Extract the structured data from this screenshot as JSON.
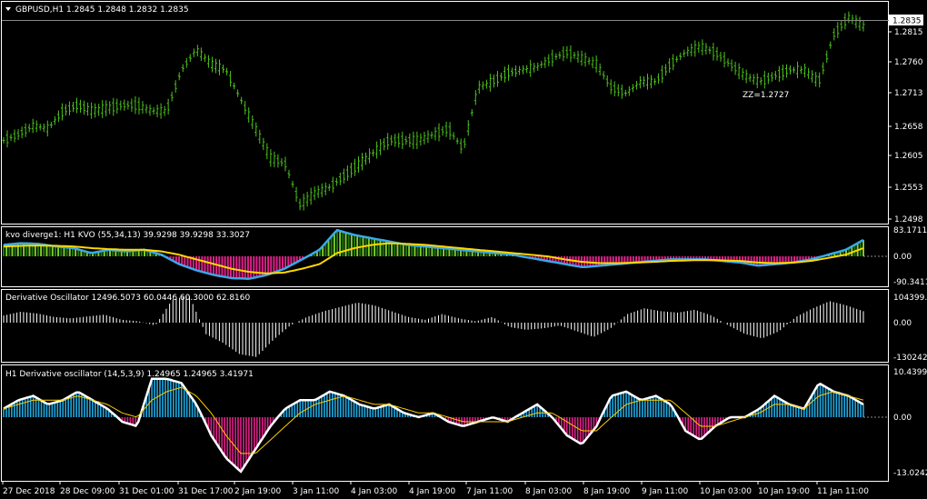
{
  "colors": {
    "background": "#000000",
    "frame": "#ffffff",
    "bull_bar": "#4cc21a",
    "histo_pos_dark": "#1f7a0a",
    "histo_pos_light": "#7ccd2a",
    "histo_neg": "#e0208a",
    "kvo_line": "#3aa8e8",
    "signal_line": "#ffd700",
    "osc_bar": "#ffffff",
    "d_fill_pos": "#1fa8e0",
    "d_fill_neg": "#e0208a",
    "d_main": "#ffffff",
    "d_signal": "#ffcc00",
    "zero_dash": "#888888"
  },
  "chart_data": [
    {
      "type": "bar",
      "name": "main-price",
      "title": "GBPUSD,H1  1.2845 1.2848 1.2832 1.2835",
      "symbol": "GBPUSD,H1",
      "ohlc": [
        1.2845,
        1.2848,
        1.2832,
        1.2835
      ],
      "y_ticks": [
        "1.2815",
        "1.2760",
        "1.2713",
        "1.2658",
        "1.2605",
        "1.2553",
        "1.2498"
      ],
      "ylim": [
        1.2498,
        1.287
      ],
      "current_price": "1.2835",
      "annotation": "ZZ=1.2727",
      "close_path": [
        1.264,
        1.265,
        1.2665,
        1.266,
        1.269,
        1.27,
        1.269,
        1.2695,
        1.27,
        1.27,
        1.269,
        1.269,
        1.276,
        1.2795,
        1.277,
        1.276,
        1.271,
        1.266,
        1.261,
        1.26,
        1.253,
        1.255,
        1.256,
        1.258,
        1.26,
        1.262,
        1.264,
        1.264,
        1.264,
        1.265,
        1.266,
        1.2625,
        1.273,
        1.274,
        1.2755,
        1.276,
        1.2765,
        1.278,
        1.279,
        1.278,
        1.277,
        1.273,
        1.272,
        1.274,
        1.274,
        1.277,
        1.279,
        1.28,
        1.279,
        1.277,
        1.275,
        1.274,
        1.275,
        1.276,
        1.276,
        1.274,
        1.282,
        1.285,
        1.2835
      ]
    },
    {
      "type": "bar",
      "name": "kvo-diverge",
      "title": "kvo diverge1: H1  KVO (55,34,13) 39.9298 39.9298 33.3027",
      "y_ticks": [
        "83.1711",
        "0.00",
        "-90.3411"
      ],
      "ylim": [
        -90.3411,
        83.1711
      ],
      "histogram": [
        35,
        40,
        38,
        30,
        25,
        10,
        20,
        15,
        20,
        5,
        -25,
        -45,
        -60,
        -70,
        -72,
        -60,
        -40,
        -10,
        20,
        80,
        65,
        55,
        45,
        35,
        30,
        25,
        20,
        15,
        10,
        5,
        -5,
        -15,
        -25,
        -35,
        -30,
        -25,
        -20,
        -15,
        -10,
        -10,
        -10,
        -15,
        -20,
        -30,
        -25,
        -20,
        -10,
        5,
        20,
        50
      ],
      "kvo": [
        35,
        40,
        38,
        30,
        25,
        10,
        20,
        15,
        20,
        5,
        -25,
        -45,
        -60,
        -70,
        -72,
        -60,
        -40,
        -10,
        20,
        80,
        65,
        55,
        45,
        35,
        30,
        25,
        20,
        15,
        10,
        5,
        -5,
        -15,
        -25,
        -35,
        -30,
        -25,
        -20,
        -15,
        -10,
        -10,
        -10,
        -15,
        -20,
        -30,
        -25,
        -20,
        -10,
        5,
        20,
        50
      ],
      "signal": [
        30,
        32,
        33,
        32,
        30,
        25,
        22,
        20,
        20,
        15,
        5,
        -10,
        -25,
        -40,
        -50,
        -55,
        -52,
        -40,
        -25,
        10,
        25,
        35,
        40,
        38,
        35,
        30,
        25,
        20,
        15,
        10,
        5,
        0,
        -10,
        -18,
        -22,
        -22,
        -20,
        -18,
        -15,
        -13,
        -12,
        -13,
        -15,
        -20,
        -22,
        -20,
        -15,
        -5,
        5,
        25
      ]
    },
    {
      "type": "bar",
      "name": "derivative-osc",
      "title": "Derivative Oscillator 12496.5073 60.0446 60.3000 62.8160",
      "y_ticks": [
        "104399.4",
        "0.00",
        "-130242.6"
      ],
      "ylim": [
        -130242.6,
        104399.4
      ],
      "values": [
        25000,
        38000,
        32000,
        20000,
        15000,
        22000,
        28000,
        10000,
        5000,
        -10000,
        80000,
        95000,
        -40000,
        -70000,
        -110000,
        -120000,
        -60000,
        -10000,
        20000,
        40000,
        55000,
        70000,
        60000,
        40000,
        20000,
        10000,
        30000,
        15000,
        5000,
        20000,
        -15000,
        -25000,
        -20000,
        -10000,
        -30000,
        -50000,
        -20000,
        30000,
        50000,
        40000,
        35000,
        45000,
        25000,
        -10000,
        -40000,
        -55000,
        -30000,
        20000,
        50000,
        75000,
        60000,
        40000
      ]
    },
    {
      "type": "area",
      "name": "h1-derivative",
      "title": "H1 Derivative oscillator (14,5,3,9) 1.24965 1.24965 3.41971",
      "y_ticks": [
        "10.43999",
        "0.00",
        "-13.02421"
      ],
      "ylim": [
        -13.02421,
        10.43999
      ],
      "x_ticks": [
        "27 Dec 2018",
        "28 Dec 09:00",
        "31 Dec 01:00",
        "31 Dec 17:00",
        "2 Jan 19:00",
        "3 Jan 11:00",
        "4 Jan 03:00",
        "4 Jan 19:00",
        "7 Jan 11:00",
        "8 Jan 03:00",
        "8 Jan 19:00",
        "9 Jan 11:00",
        "10 Jan 03:00",
        "10 Jan 19:00",
        "11 Jan 11:00"
      ],
      "main": [
        2,
        4,
        5,
        3,
        4,
        6,
        4,
        2,
        -1,
        -2,
        9,
        9,
        8,
        3,
        -4,
        -9,
        -12,
        -7,
        -2,
        2,
        4,
        4,
        6,
        5,
        3,
        2,
        3,
        1,
        0,
        1,
        -1,
        -2,
        -1,
        0,
        -1,
        1,
        3,
        0,
        -4,
        -6,
        -2,
        5,
        6,
        4,
        5,
        3,
        -3,
        -5,
        -2,
        0,
        0,
        2,
        5,
        3,
        2,
        8,
        6,
        5,
        3
      ],
      "signal": [
        2,
        3,
        4,
        4,
        4,
        5,
        4,
        3,
        1,
        0,
        4,
        6,
        7,
        5,
        1,
        -4,
        -8,
        -8,
        -5,
        -2,
        1,
        3,
        4,
        5,
        4,
        3,
        3,
        2,
        1,
        1,
        0,
        -1,
        -1,
        -1,
        -1,
        0,
        1,
        1,
        -1,
        -3,
        -3,
        0,
        3,
        4,
        4,
        4,
        1,
        -2,
        -2,
        -1,
        0,
        1,
        3,
        3,
        2,
        5,
        6,
        5,
        4
      ]
    }
  ]
}
